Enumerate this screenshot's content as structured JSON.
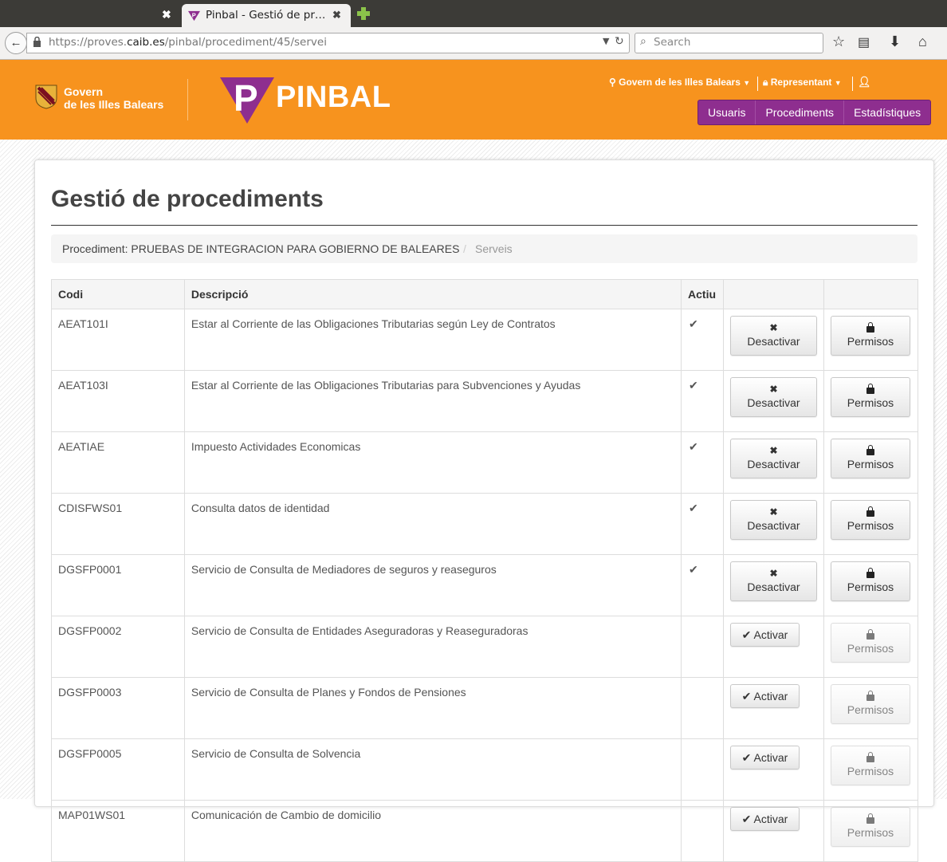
{
  "browser": {
    "tab_title": "Pinbal - Gestió de pr…",
    "url_prefix": "https://proves.",
    "url_host": "caib.es",
    "url_path": "/pinbal/procediment/45/servei",
    "search_placeholder": "Search"
  },
  "header": {
    "govern_line1": "Govern",
    "govern_line2": "de les Illes Balears",
    "app_name": "PINBAL",
    "entity_menu": "Govern de les Illes Balears",
    "role_menu": "Representant",
    "nav": [
      "Usuaris",
      "Procediments",
      "Estadístiques"
    ],
    "colors": {
      "header_bg": "#f7931e",
      "menu_bg": "#8e2e8f"
    }
  },
  "page": {
    "title": "Gestió de procediments",
    "breadcrumb": {
      "procedure": "Procediment: PRUEBAS DE INTEGRACION PARA GOBIERNO DE BALEARES",
      "separator": "/",
      "current": "Serveis"
    }
  },
  "table": {
    "headers": [
      "Codi",
      "Descripció",
      "Actiu",
      "",
      ""
    ],
    "rows": [
      {
        "code": "AEAT101I",
        "desc": "Estar al Corriente de las Obligaciones Tributarias según Ley de Contratos",
        "active_mark": "✔",
        "action": "Desactivar",
        "permissions": "Permisos"
      },
      {
        "code": "AEAT103I",
        "desc": "Estar al Corriente de las Obligaciones Tributarias para Subvenciones y Ayudas",
        "active_mark": "✔",
        "action": "Desactivar",
        "permissions": "Permisos"
      },
      {
        "code": "AEATIAE",
        "desc": "Impuesto Actividades Economicas",
        "active_mark": "✔",
        "action": "Desactivar",
        "permissions": "Permisos"
      },
      {
        "code": "CDISFWS01",
        "desc": "Consulta datos de identidad",
        "active_mark": "✔",
        "action": "Desactivar",
        "permissions": "Permisos"
      },
      {
        "code": "DGSFP0001",
        "desc": "Servicio de Consulta de Mediadores de seguros y reaseguros",
        "active_mark": "✔",
        "action": "Desactivar",
        "permissions": "Permisos"
      },
      {
        "code": "DGSFP0002",
        "desc": "Servicio de Consulta de Entidades Aseguradoras y Reaseguradoras",
        "active_mark": "",
        "action": "Activar",
        "permissions": "Permisos"
      },
      {
        "code": "DGSFP0003",
        "desc": "Servicio de Consulta de Planes y Fondos de Pensiones",
        "active_mark": "",
        "action": "Activar",
        "permissions": "Permisos"
      },
      {
        "code": "DGSFP0005",
        "desc": "Servicio de Consulta de Solvencia",
        "active_mark": "",
        "action": "Activar",
        "permissions": "Permisos"
      },
      {
        "code": "MAP01WS01",
        "desc": "Comunicación de Cambio de domicilio",
        "active_mark": "",
        "action": "Activar",
        "permissions": "Permisos"
      }
    ]
  }
}
